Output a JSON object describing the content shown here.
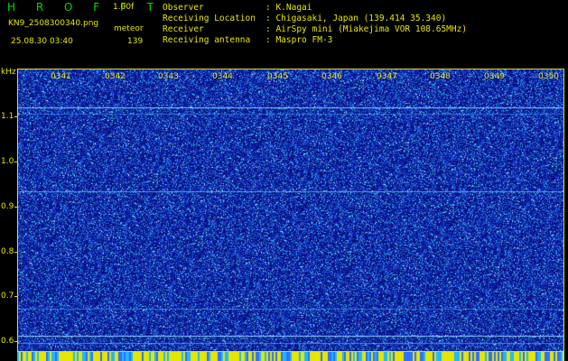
{
  "header": {
    "app_title": "H R O F F T",
    "version": "1.00f",
    "file_name": "KN9_2508300340.png",
    "meteor_label": "meteor",
    "datetime": "25.08.30 03:40",
    "count": "139"
  },
  "info_rows": [
    {
      "key": "Observer",
      "value": ": K.Nagai"
    },
    {
      "key": "Receiving Location",
      "value": ": Chigasaki, Japan (139.414 35.340)"
    },
    {
      "key": "Receiver",
      "value": ": AirSpy mini (Miakejima VOR 108.65MHz)"
    },
    {
      "key": "Receiving antenna",
      "value": ": Maspro FM-3"
    }
  ],
  "axis": {
    "y_unit": "kHz",
    "y_ticks": [
      "1.1",
      "1.0",
      "0.9",
      "0.8",
      "0.7",
      "0.6"
    ],
    "x_ticks": [
      "0341",
      "0342",
      "0343",
      "0344",
      "0345",
      "0346",
      "0347",
      "0348",
      "0349",
      "0350"
    ]
  },
  "colors": {
    "background": "#000000",
    "title": "#00d800",
    "text": "#e6e600",
    "waterfall_base": "#0d1a8a"
  }
}
